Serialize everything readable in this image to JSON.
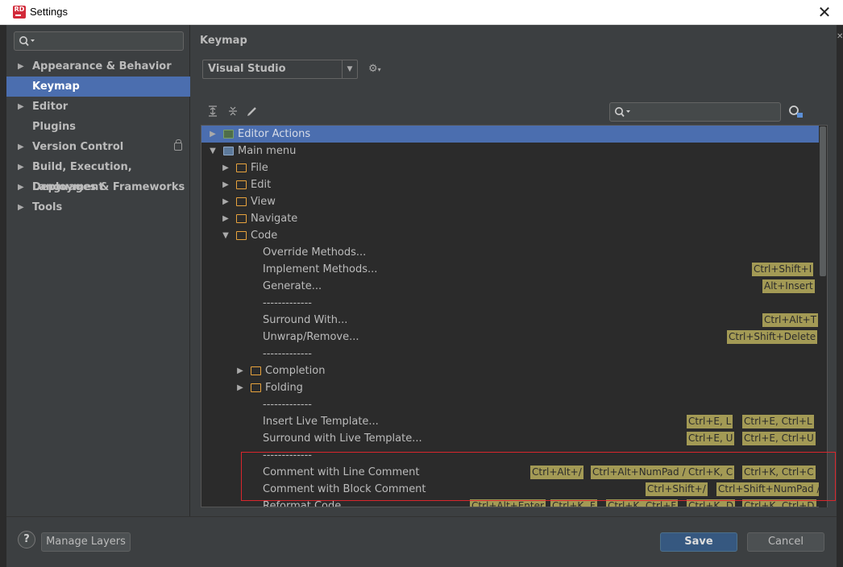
{
  "window": {
    "title": "Settings",
    "close_glyph": "✕"
  },
  "left_panel": {
    "search": {
      "placeholder": ""
    },
    "items": [
      {
        "label": "Appearance & Behavior",
        "expandable": true,
        "selected": false
      },
      {
        "label": "Keymap",
        "expandable": false,
        "selected": true
      },
      {
        "label": "Editor",
        "expandable": true,
        "selected": false
      },
      {
        "label": "Plugins",
        "expandable": false,
        "selected": false
      },
      {
        "label": "Version Control",
        "expandable": true,
        "selected": false,
        "icon": "lock-icon"
      },
      {
        "label": "Build, Execution, Deployment",
        "expandable": true,
        "selected": false
      },
      {
        "label": "Languages & Frameworks",
        "expandable": true,
        "selected": false
      },
      {
        "label": "Tools",
        "expandable": true,
        "selected": false
      }
    ]
  },
  "main": {
    "section_title": "Keymap",
    "keymap_select": {
      "value": "Visual Studio"
    },
    "toolbar": {
      "expand_all_icon": "expand-all-icon",
      "collapse_all_icon": "collapse-all-icon",
      "edit_icon": "pencil-icon"
    },
    "tree_search": {
      "placeholder": ""
    }
  },
  "tree": [
    {
      "label": "Editor Actions",
      "indent": 0,
      "toggle": "▶",
      "folder": "green",
      "selected": true,
      "shortcuts": []
    },
    {
      "label": "Main menu",
      "indent": 0,
      "toggle": "▼",
      "folder": "blue",
      "selected": false,
      "shortcuts": []
    },
    {
      "label": "File",
      "indent": 1,
      "toggle": "▶",
      "folder": "orange",
      "shortcuts": []
    },
    {
      "label": "Edit",
      "indent": 1,
      "toggle": "▶",
      "folder": "orange",
      "shortcuts": []
    },
    {
      "label": "View",
      "indent": 1,
      "toggle": "▶",
      "folder": "orange",
      "shortcuts": []
    },
    {
      "label": "Navigate",
      "indent": 1,
      "toggle": "▶",
      "folder": "orange",
      "shortcuts": []
    },
    {
      "label": "Code",
      "indent": 1,
      "toggle": "▼",
      "folder": "orange",
      "shortcuts": []
    },
    {
      "label": "Override Methods...",
      "indent": 2,
      "shortcuts": []
    },
    {
      "label": "Implement Methods...",
      "indent": 2,
      "shortcuts": [
        "Ctrl+Shift+I"
      ]
    },
    {
      "label": "Generate...",
      "indent": 2,
      "shortcuts": [
        "Alt+Insert"
      ]
    },
    {
      "label": "-------------",
      "indent": 2,
      "shortcuts": []
    },
    {
      "label": "Surround With...",
      "indent": 2,
      "shortcuts": [
        "Ctrl+Alt+T"
      ]
    },
    {
      "label": "Unwrap/Remove...",
      "indent": 2,
      "shortcuts": [
        "Ctrl+Shift+Delete"
      ]
    },
    {
      "label": "-------------",
      "indent": 2,
      "shortcuts": []
    },
    {
      "label": "Completion",
      "indent": 2,
      "toggle": "▶",
      "folder": "orange",
      "shortcuts": []
    },
    {
      "label": "Folding",
      "indent": 2,
      "toggle": "▶",
      "folder": "orange",
      "shortcuts": []
    },
    {
      "label": "-------------",
      "indent": 2,
      "shortcuts": []
    },
    {
      "label": "Insert Live Template...",
      "indent": 2,
      "shortcuts": [
        "Ctrl+E, L",
        "Ctrl+E, Ctrl+L"
      ]
    },
    {
      "label": "Surround with Live Template...",
      "indent": 2,
      "shortcuts": [
        "Ctrl+E, U",
        "Ctrl+E, Ctrl+U"
      ]
    },
    {
      "label": "-------------",
      "indent": 2,
      "shortcuts": []
    },
    {
      "label": "Comment with Line Comment",
      "indent": 2,
      "shortcuts": [
        "Ctrl+Alt+/",
        "Ctrl+Alt+NumPad /",
        "Ctrl+K, C",
        "Ctrl+K, Ctrl+C"
      ]
    },
    {
      "label": "Comment with Block Comment",
      "indent": 2,
      "shortcuts": [
        "Ctrl+Shift+/",
        "Ctrl+Shift+NumPad /"
      ]
    },
    {
      "label": "Reformat Code",
      "indent": 2,
      "shortcuts": [
        "Ctrl+Alt+Enter",
        "Ctrl+K, F",
        "Ctrl+K, Ctrl+F",
        "Ctrl+K, D",
        "Ctrl+K, Ctrl+D"
      ]
    }
  ],
  "footer": {
    "help_label": "?",
    "manage_layers_label": "Manage Layers",
    "save_label": "Save",
    "cancel_label": "Cancel"
  },
  "colors": {
    "selection": "#4b6eaf",
    "shortcut_badge": "#a39a55",
    "highlight_box": "#d9262c",
    "folder": "#e8a33d"
  }
}
